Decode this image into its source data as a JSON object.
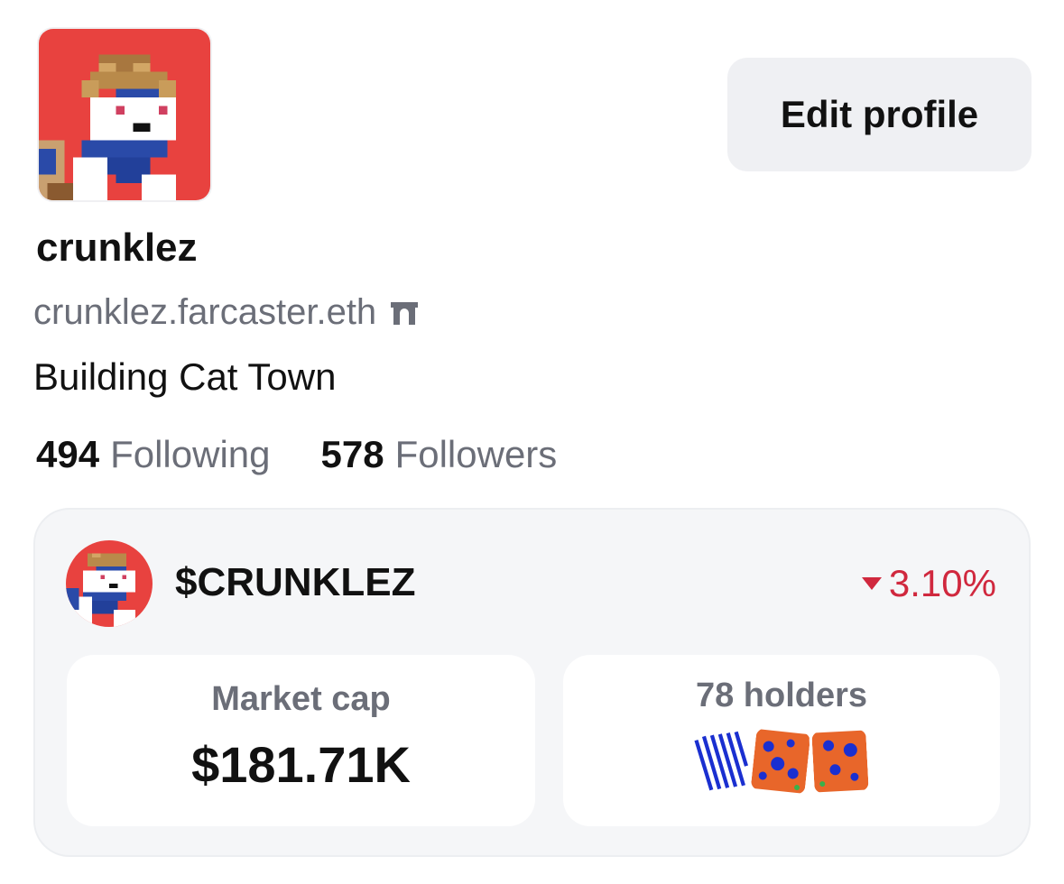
{
  "profile": {
    "display_name": "crunklez",
    "fname": "crunklez.farcaster.eth",
    "bio": "Building Cat Town",
    "following_count": "494",
    "following_label": "Following",
    "followers_count": "578",
    "followers_label": "Followers",
    "edit_button_label": "Edit profile",
    "fname_icon": "farcaster-arch-icon"
  },
  "token": {
    "symbol": "$CRUNKLEZ",
    "change": "3.10%",
    "change_direction": "down",
    "change_color": "#d0283e",
    "market_cap_label": "Market cap",
    "market_cap_value": "$181.71K",
    "holders_label": "78 holders"
  },
  "colors": {
    "avatar_background": "#e8423f",
    "card_background": "#f5f6f8",
    "secondary_text": "#6b6e78"
  }
}
